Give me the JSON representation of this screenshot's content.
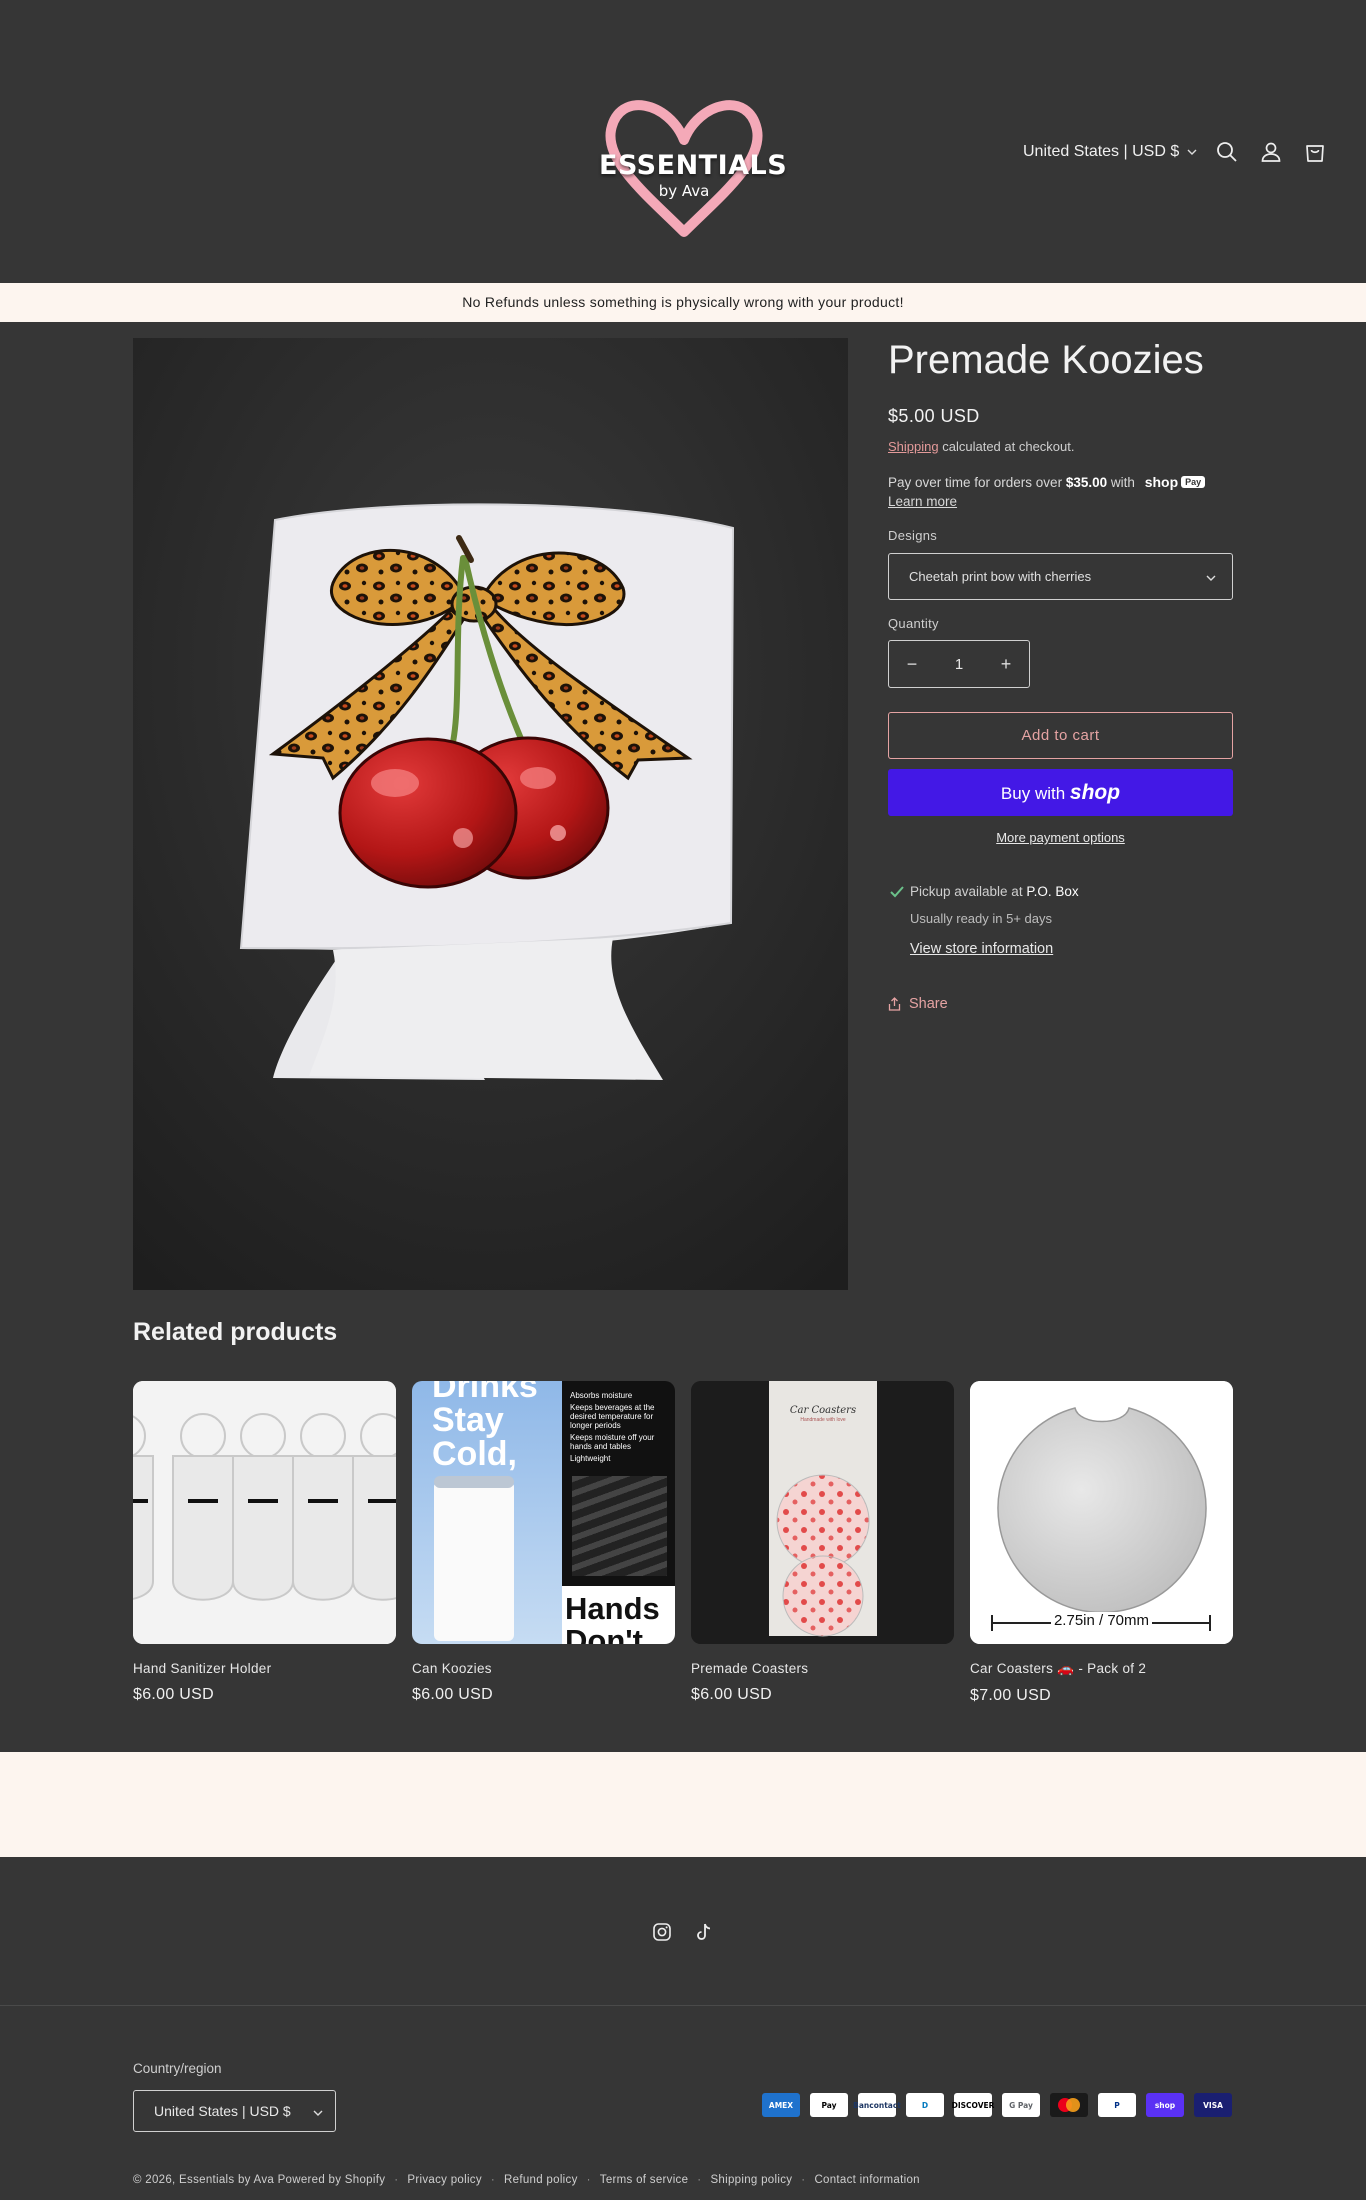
{
  "brand": {
    "logo_main": "ESSENTIALS",
    "logo_sub": "by Ava",
    "logo_heart_color": "#f4a9b8"
  },
  "header": {
    "locale_label": "United States | USD $",
    "icons": [
      "search-icon",
      "account-icon",
      "cart-icon"
    ]
  },
  "announcement": "No Refunds unless something is physically wrong with your product!",
  "product": {
    "title": "Premade Koozies",
    "price": "$5.00 USD",
    "shipping_link": "Shipping",
    "shipping_text": "calculated at checkout.",
    "payover_prefix": "Pay over time for orders over",
    "payover_amount": "$35.00",
    "payover_suffix": "with",
    "shoppay_brand": "shop",
    "shoppay_badge": "Pay",
    "learn_more": "Learn more",
    "designs_label": "Designs",
    "design_selected": "Cheetah print bow with cherries",
    "quantity_label": "Quantity",
    "quantity_value": "1",
    "add_to_cart": "Add to cart",
    "buy_with": "Buy with",
    "buy_shop": "shop",
    "more_payment": "More payment options",
    "pickup_prefix": "Pickup available at",
    "pickup_location": "P.O. Box",
    "ready_text": "Usually ready in 5+ days",
    "store_info": "View store information",
    "share": "Share"
  },
  "related": {
    "title": "Related products",
    "items": [
      {
        "name": "Hand Sanitizer Holder",
        "price": "$6.00 USD"
      },
      {
        "name": "Can Koozies",
        "price": "$6.00 USD",
        "img_text_1": "Drinks",
        "img_text_2": "Stay",
        "img_text_3": "Cold,",
        "img_bullets": [
          "Absorbs moisture",
          "Keeps beverages at the desired temperature for longer periods",
          "Keeps moisture off your hands and tables",
          "Lightweight"
        ],
        "img_text_4": "Hands",
        "img_text_5": "Don't"
      },
      {
        "name": "Premade Coasters",
        "price": "$6.00 USD",
        "img_label": "Car Coasters",
        "img_sublabel": "Handmade with love"
      },
      {
        "name": "Car Coasters 🚗 - Pack of 2",
        "price": "$7.00 USD",
        "img_dimension": "2.75in / 70mm"
      }
    ]
  },
  "footer": {
    "social": [
      "instagram-icon",
      "tiktok-icon"
    ],
    "country_label": "Country/region",
    "country_value": "United States | USD $",
    "payments": [
      {
        "name": "amex",
        "label": "AMEX",
        "bg": "#1f72cd",
        "fg": "#ffffff"
      },
      {
        "name": "apple-pay",
        "label": "Pay",
        "bg": "#ffffff",
        "fg": "#000000"
      },
      {
        "name": "bancontact",
        "label": "Bancontact",
        "bg": "#ffffff",
        "fg": "#1e3764"
      },
      {
        "name": "diners",
        "label": "D",
        "bg": "#ffffff",
        "fg": "#0079be"
      },
      {
        "name": "discover",
        "label": "DISCOVER",
        "bg": "#ffffff",
        "fg": "#000000"
      },
      {
        "name": "google-pay",
        "label": "G Pay",
        "bg": "#ffffff",
        "fg": "#5f6368"
      },
      {
        "name": "mastercard",
        "label": "",
        "bg": "#1a1a1a",
        "fg": "#ffffff"
      },
      {
        "name": "paypal",
        "label": "P",
        "bg": "#ffffff",
        "fg": "#003087"
      },
      {
        "name": "shop-pay",
        "label": "shop",
        "bg": "#5a31f4",
        "fg": "#ffffff"
      },
      {
        "name": "visa",
        "label": "VISA",
        "bg": "#1a1f71",
        "fg": "#ffffff"
      }
    ],
    "copyright": "© 2026,",
    "store_name": "Essentials by Ava",
    "powered": "Powered by Shopify",
    "links": [
      "Privacy policy",
      "Refund policy",
      "Terms of service",
      "Shipping policy",
      "Contact information"
    ]
  }
}
